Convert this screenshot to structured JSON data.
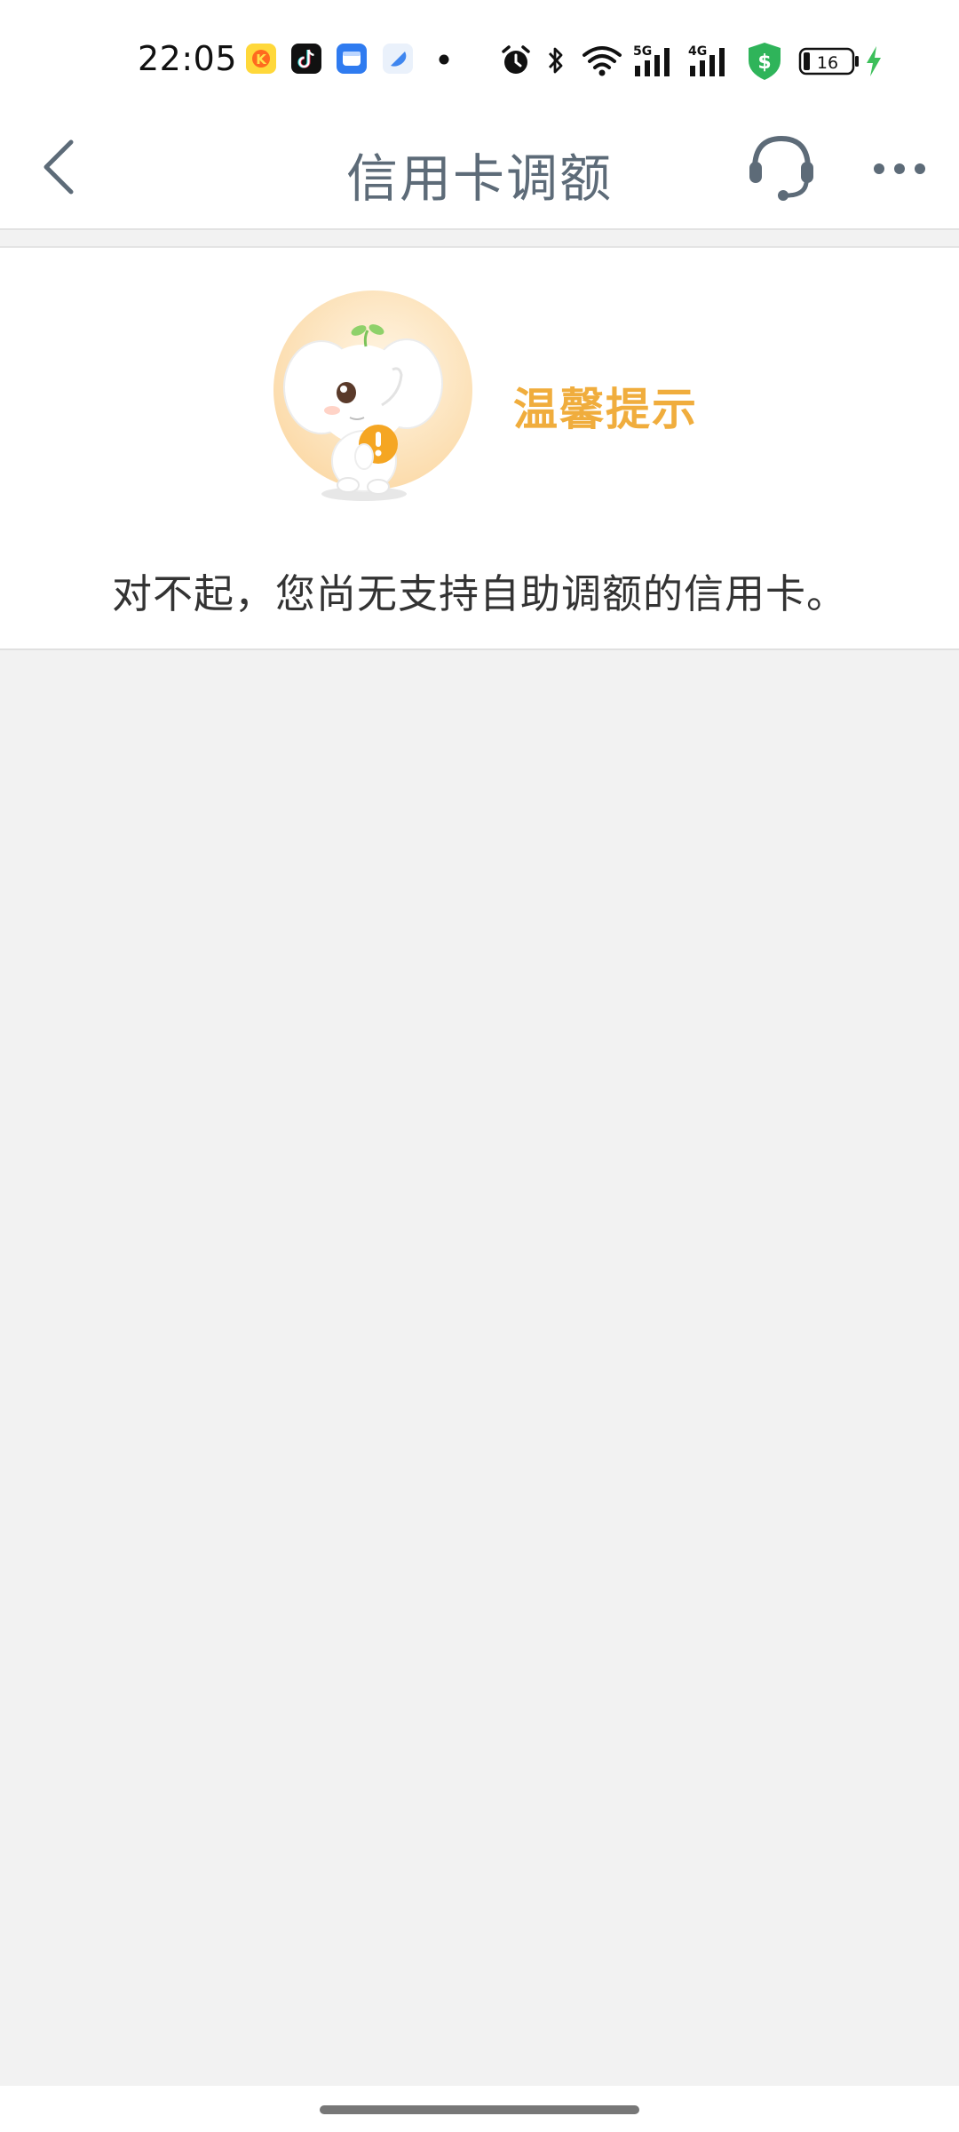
{
  "status_bar": {
    "time": "22:05",
    "battery_level": "16",
    "network_labels": [
      "5G",
      "4G"
    ],
    "notification_icons": [
      "kuaishou-icon",
      "tiktok-icon",
      "message-app-icon",
      "blue-app-icon",
      "more-dot-icon"
    ],
    "system_icons": [
      "alarm-icon",
      "bluetooth-icon",
      "wifi-icon",
      "signal-5g-icon",
      "signal-4g-icon",
      "security-shield-icon",
      "battery-icon",
      "charging-icon"
    ]
  },
  "nav": {
    "title": "信用卡调额",
    "back_icon": "chevron-left-icon",
    "service_icon": "headset-icon",
    "more_icon": "more-horizontal-icon"
  },
  "tip": {
    "title": "温馨提示",
    "message": "对不起，您尚无支持自助调额的信用卡。",
    "mascot": "elephant-mascot-image"
  },
  "colors": {
    "accent_orange": "#f0ad3d",
    "nav_text": "#5d6b78",
    "page_background": "#f2f2f2",
    "security_green": "#2fb45a",
    "charging_green": "#3cbf5a"
  }
}
